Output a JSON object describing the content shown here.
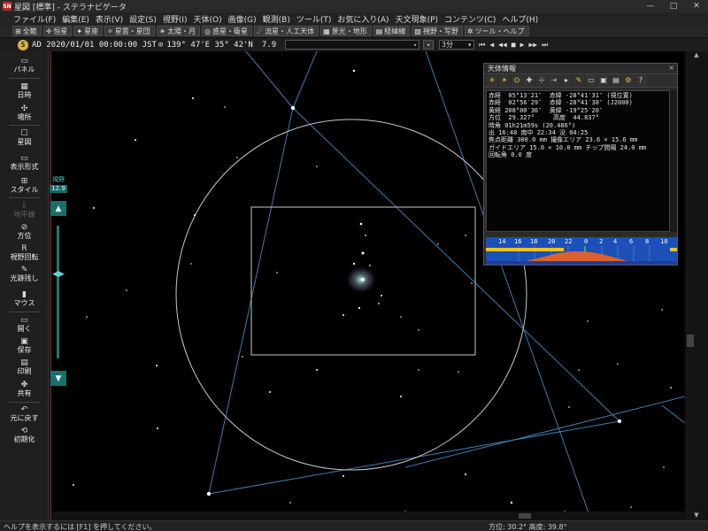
{
  "window": {
    "title": "星図 [標準] - ステラナビゲータ",
    "controls": [
      "—",
      "□",
      "✕"
    ]
  },
  "menu": [
    "ファイル(F)",
    "編集(E)",
    "表示(V)",
    "設定(S)",
    "視野(I)",
    "天体(O)",
    "画像(G)",
    "観測(B)",
    "ツール(T)",
    "お気に入り(A)",
    "天文現象(P)",
    "コンテンツ(C)",
    "ヘルプ(H)"
  ],
  "toolbar": [
    {
      "icon": "⊞",
      "label": "全範"
    },
    {
      "icon": "✛",
      "label": "恒星"
    },
    {
      "icon": "✦",
      "label": "星座"
    },
    {
      "icon": "✧",
      "label": "星雲・星団"
    },
    {
      "icon": "☀",
      "label": "太陽・月"
    },
    {
      "icon": "◎",
      "label": "惑星・衛星"
    },
    {
      "icon": "☄",
      "label": "流星・人工天体"
    },
    {
      "icon": "▦",
      "label": "景光・地形"
    },
    {
      "icon": "▤",
      "label": "経緯線"
    },
    {
      "icon": "▧",
      "label": "視野・写野"
    },
    {
      "icon": "✲",
      "label": "ツール・ヘルプ"
    }
  ],
  "timebar": {
    "era_icon": "S",
    "datetime": "AD 2020/01/01 00:00:00 JST",
    "location": "139° 47'E 35° 42'N",
    "magnitude": "7.9",
    "step": "3分"
  },
  "left_panel": [
    {
      "icon": "▭",
      "label": "パネル",
      "enabled": true
    },
    {
      "icon": "▦",
      "label": "日時",
      "enabled": true
    },
    {
      "icon": "✣",
      "label": "場所",
      "enabled": true
    },
    {
      "icon": "☐",
      "label": "星図",
      "enabled": true
    },
    {
      "icon": "▭",
      "label": "表示形式",
      "enabled": true
    },
    {
      "icon": "⊞",
      "label": "スタイル",
      "enabled": true
    },
    {
      "icon": "⇩",
      "label": "地平線",
      "enabled": false
    },
    {
      "icon": "⊘",
      "label": "方位",
      "enabled": true
    },
    {
      "icon": "R",
      "label": "視野回転",
      "enabled": true
    },
    {
      "icon": "✎",
      "label": "光跡残し",
      "enabled": true
    },
    {
      "icon": "▮",
      "label": "マウス",
      "enabled": true
    },
    {
      "icon": "▭",
      "label": "開く",
      "enabled": true
    },
    {
      "icon": "▣",
      "label": "保存",
      "enabled": true
    },
    {
      "icon": "▤",
      "label": "印刷",
      "enabled": true
    },
    {
      "icon": "✤",
      "label": "共有",
      "enabled": true
    },
    {
      "icon": "↶",
      "label": "元に戻す",
      "enabled": true
    },
    {
      "icon": "⟲",
      "label": "初期化",
      "enabled": true
    }
  ],
  "fov": {
    "label": "視野",
    "value": "12.9",
    "up_icon": "▲",
    "down_icon": "▼",
    "handle_icon": "◀▶"
  },
  "info_window": {
    "title": "天体情報",
    "close": "×",
    "tool_icons": [
      "✳",
      "✴",
      "⛭",
      "✚",
      "⊹",
      "⇢",
      "▸",
      "✎",
      "▭",
      "▣",
      "▤",
      "⚙",
      "?"
    ],
    "lines": [
      "赤経  05°13′21″  赤緯 -28°41′31″ (視位置)",
      "赤経  02°56′29″  赤緯 -28°41′38″ (J2000)",
      "黄経 208°00′36″  黄緯 -19°25′20″",
      "方位  29.327°     高度  44.837°",
      "時角 01h21m59s (20.486°)",
      "出 16:48 南中 22:34 没 04:25",
      "焦点距離 300.0 mm 撮像エリア 23.6 × 15.6 mm",
      "ガイドエリア 15.0 × 10.0 mm チップ間隔 24.0 mm",
      "回転角 0.0 度"
    ],
    "timeline_ticks": [
      "14",
      "16",
      "18",
      "20",
      "22",
      "0",
      "2",
      "4",
      "6",
      "8",
      "10"
    ]
  },
  "status": {
    "help": "ヘルプを表示するには [F1] を押してください。",
    "coords": "方位: 30.2° 高度: 39.8°"
  },
  "colors": {
    "background": "#000000",
    "accent_teal": "#1b6e6a",
    "constellation_line": "#3a7fb0",
    "fov_circle": "#c8c8c8",
    "timeline": "#1c4fb8",
    "altitude_curve": "#e0602a",
    "twilight": "#f0c020"
  }
}
